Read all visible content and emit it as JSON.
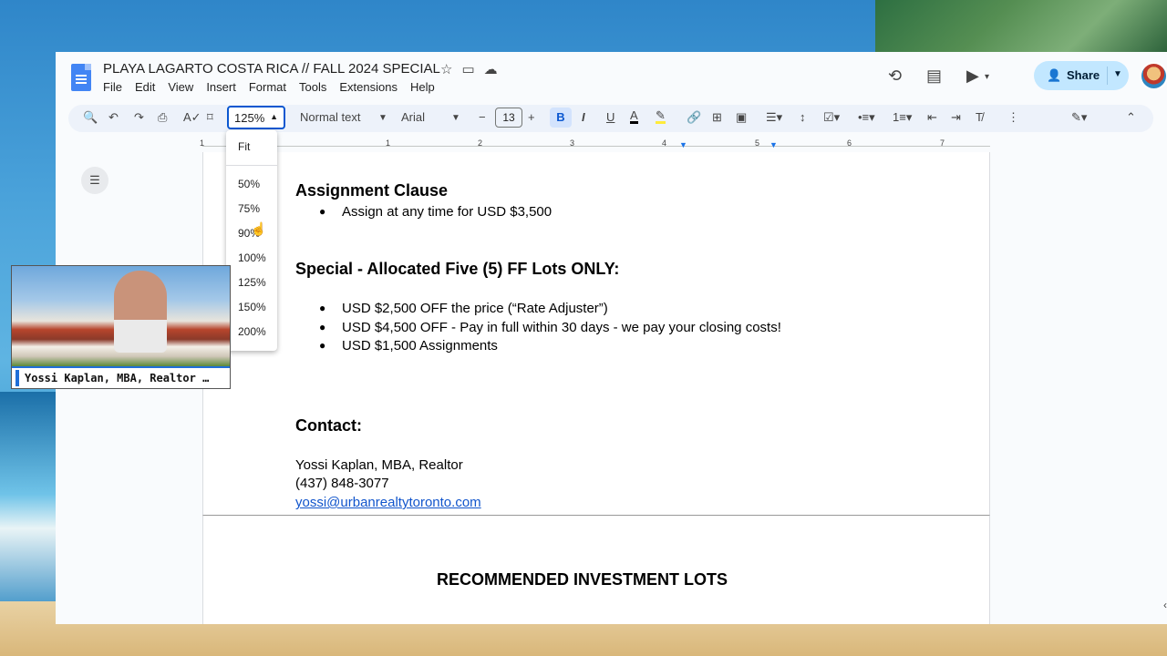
{
  "doc": {
    "title": "PLAYA LAGARTO COSTA RICA // FALL 2024 SPECIAL",
    "menu": [
      "File",
      "Edit",
      "View",
      "Insert",
      "Format",
      "Tools",
      "Extensions",
      "Help"
    ],
    "share_label": "Share"
  },
  "toolbar": {
    "zoom_value": "125%",
    "style_value": "Normal text",
    "font_value": "Arial",
    "font_size": "13",
    "bold_label": "B",
    "italic_label": "I",
    "underline_label": "U"
  },
  "ruler": {
    "numbers": [
      "1",
      "1",
      "2",
      "3",
      "4",
      "5",
      "6",
      "7"
    ]
  },
  "zoom_menu": {
    "options": [
      "Fit",
      "50%",
      "75%",
      "90%",
      "100%",
      "125%",
      "150%",
      "200%"
    ]
  },
  "content": {
    "assignment_heading": "Assignment Clause",
    "assignment_bullet": "Assign at any time for USD $3,500",
    "special_heading": "Special - Allocated Five (5) FF Lots ONLY:",
    "special_bullets": [
      "USD $2,500 OFF the price (“Rate Adjuster”)",
      "USD $4,500 OFF - Pay in full within 30 days - we pay your closing costs!",
      "USD $1,500 Assignments"
    ],
    "contact_heading": "Contact:",
    "contact_name": "Yossi Kaplan, MBA, Realtor",
    "contact_phone": "(437) 848-3077",
    "contact_email": "yossi@urbanrealtytoronto.com",
    "page2_heading": "RECOMMENDED INVESTMENT LOTS"
  },
  "webcam": {
    "label": "Yossi Kaplan, MBA, Realtor …"
  }
}
